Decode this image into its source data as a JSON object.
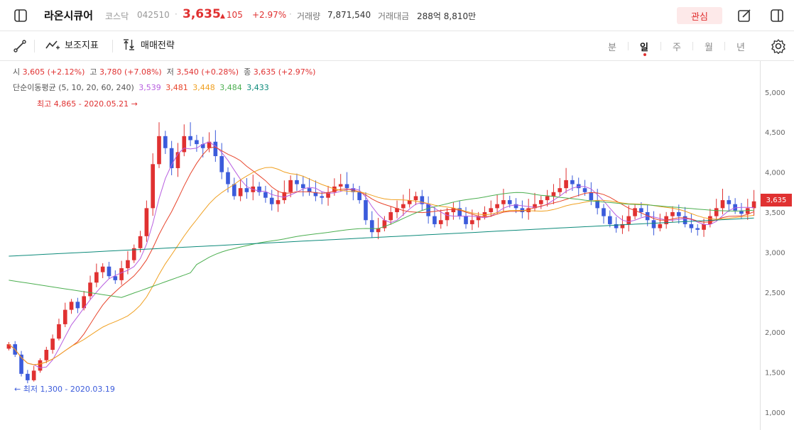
{
  "header": {
    "name": "라온시큐어",
    "market": "코스닥",
    "code": "042510",
    "separator": "·",
    "price": "3,635",
    "change": "105",
    "change_pct": "+2.97%",
    "volume_label": "거래량",
    "volume": "7,871,540",
    "amount_label": "거래대금",
    "amount": "288억 8,810만",
    "favorite_label": "관심",
    "up_arrow": "▲"
  },
  "toolbar": {
    "indicator_label": "보조지표",
    "strategy_label": "매매전략",
    "periods": [
      "분",
      "일",
      "주",
      "월",
      "년"
    ],
    "active_period": "일"
  },
  "legend": {
    "open_label": "시",
    "open": "3,605 (+2.12%)",
    "high_label": "고",
    "high": "3,780 (+7.08%)",
    "low_label": "저",
    "low": "3,540 (+0.28%)",
    "close_label": "종",
    "close": "3,635 (+2.97%)",
    "ma_label": "단순이동평균 (5, 10, 20, 60, 240)",
    "ma_values": [
      "3,539",
      "3,481",
      "3,448",
      "3,484",
      "3,433"
    ],
    "ma_colors": [
      "#b85fe0",
      "#e8452c",
      "#f0a020",
      "#4caf50",
      "#0c8a7a"
    ]
  },
  "annotations": {
    "max_note": "최고 4,865 - 2020.05.21 →",
    "min_note": "← 최저 1,300 - 2020.03.19"
  },
  "colors": {
    "up": "#e03131",
    "down": "#3b5bdb",
    "accent": "#e03131"
  },
  "chart_data": {
    "type": "candlestick",
    "y_ticks": [
      "5,000",
      "4,500",
      "4,000",
      "3,500",
      "3,000",
      "2,500",
      "2,000",
      "1,500",
      "1,000"
    ],
    "y_tick_values": [
      5000,
      4500,
      4000,
      3500,
      3000,
      2500,
      2000,
      1500,
      1000
    ],
    "ylim": [
      900,
      5300
    ],
    "last_price_label": "3,635",
    "close_series": [
      1850,
      1720,
      1480,
      1400,
      1520,
      1650,
      1780,
      1920,
      2100,
      2280,
      2380,
      2300,
      2450,
      2620,
      2750,
      2820,
      2700,
      2650,
      2800,
      2900,
      3050,
      3200,
      3550,
      4100,
      4450,
      4300,
      4050,
      4250,
      4450,
      4400,
      4350,
      4300,
      4380,
      4200,
      4000,
      3850,
      3700,
      3800,
      3750,
      3820,
      3750,
      3680,
      3600,
      3650,
      3750,
      3900,
      3850,
      3800,
      3750,
      3700,
      3680,
      3750,
      3820,
      3850,
      3800,
      3750,
      3650,
      3400,
      3250,
      3300,
      3400,
      3500,
      3550,
      3600,
      3650,
      3700,
      3600,
      3450,
      3350,
      3400,
      3500,
      3550,
      3450,
      3350,
      3400,
      3450,
      3500,
      3550,
      3600,
      3650,
      3600,
      3550,
      3500,
      3550,
      3600,
      3650,
      3700,
      3750,
      3800,
      3900,
      3850,
      3800,
      3750,
      3650,
      3550,
      3450,
      3350,
      3300,
      3350,
      3450,
      3550,
      3500,
      3400,
      3300,
      3350,
      3450,
      3500,
      3450,
      3350,
      3300,
      3280,
      3350,
      3450,
      3550,
      3650,
      3600,
      3520,
      3480,
      3550,
      3635
    ]
  }
}
